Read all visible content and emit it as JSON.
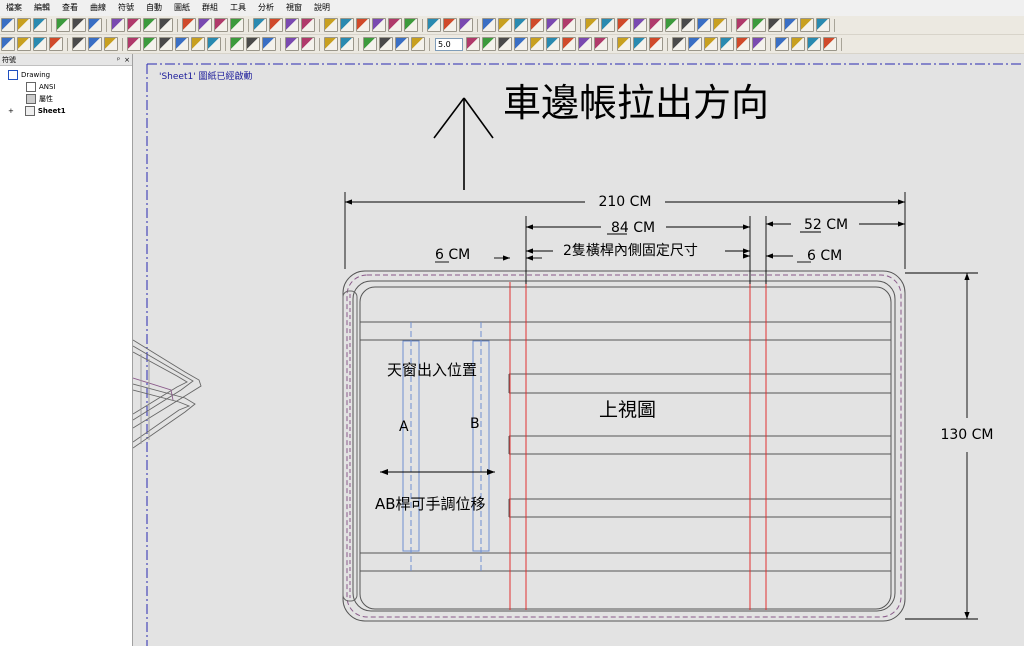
{
  "menu": [
    "檔案",
    "編輯",
    "查看",
    "曲線",
    "符號",
    "自動",
    "圖紙",
    "群組",
    "工具",
    "分析",
    "視窗",
    "說明"
  ],
  "toolbar2": {
    "line_width": "5.0"
  },
  "panel": {
    "title": "符號",
    "pin": "ᵖ",
    "close": "×"
  },
  "tree": {
    "root": "Drawing",
    "standard": "ANSI",
    "props": "屬性",
    "sheet": "Sheet1"
  },
  "status": "'Sheet1' 圖紙已經啟動",
  "drawing": {
    "direction": "車邊帳拉出方向",
    "dim_total_width": "210 CM",
    "dim_inner": "84 CM",
    "dim_right": "52 CM",
    "dim_left_gap": "6 CM",
    "dim_right_gap": "6 CM",
    "dim_height": "130 CM",
    "inner_note": "2隻橫桿內側固定尺寸",
    "skylight_label": "天窗出入位置",
    "label_a": "A",
    "label_b": "B",
    "ab_note": "AB桿可手調位移",
    "top_view": "上視圖"
  }
}
